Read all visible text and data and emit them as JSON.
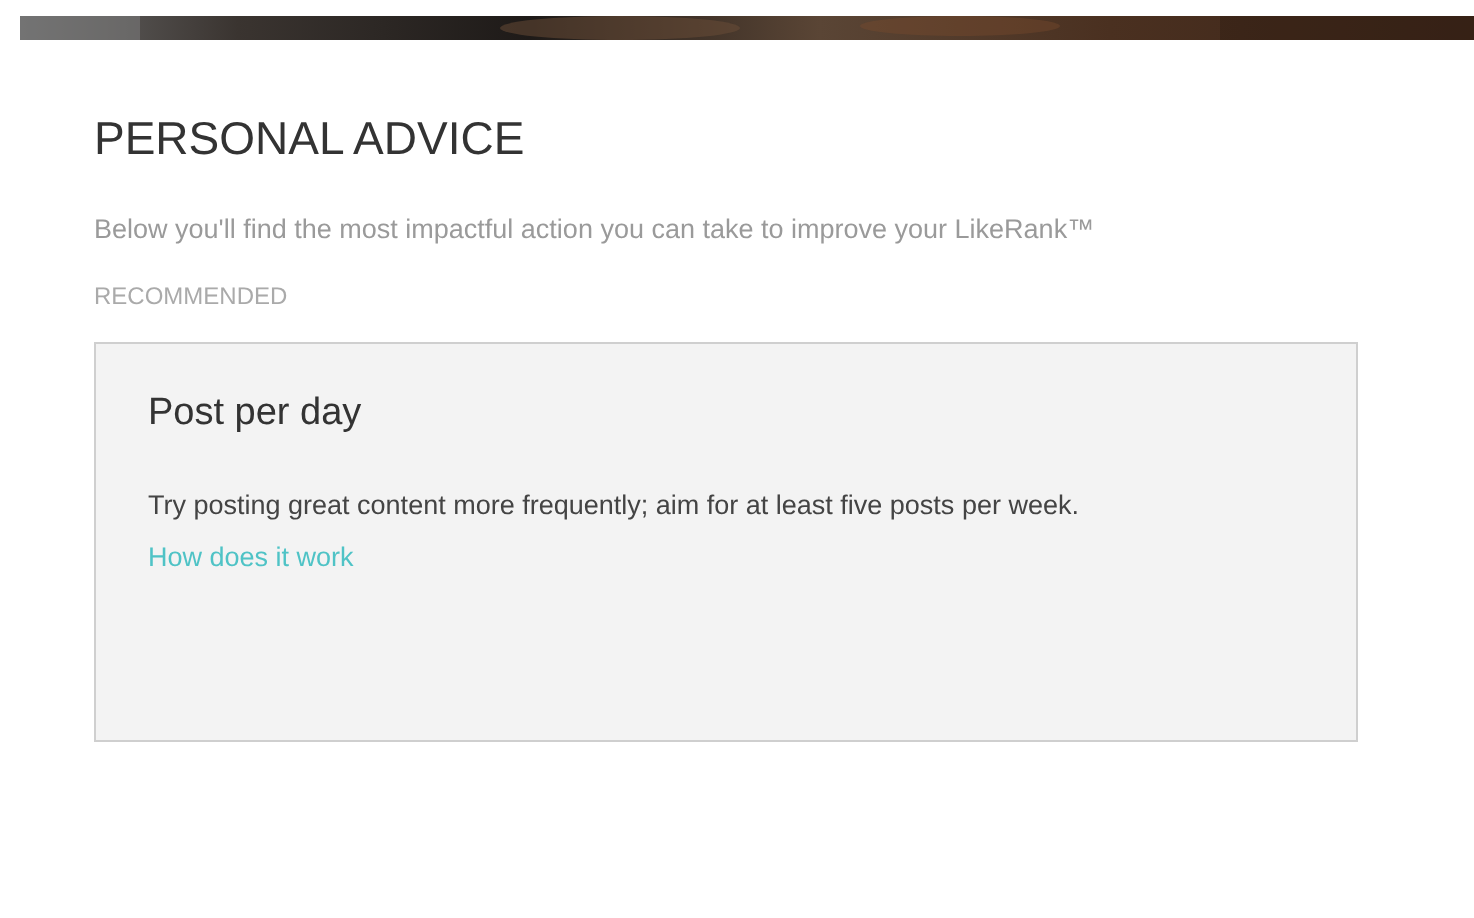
{
  "title": "PERSONAL ADVICE",
  "description": "Below you'll find the most impactful action you can take to improve your LikeRank™",
  "section_label": "RECOMMENDED",
  "advice_card": {
    "title": "Post per day",
    "body": "Try posting great content more frequently; aim for at least five posts per week.",
    "link": "How does it work"
  }
}
